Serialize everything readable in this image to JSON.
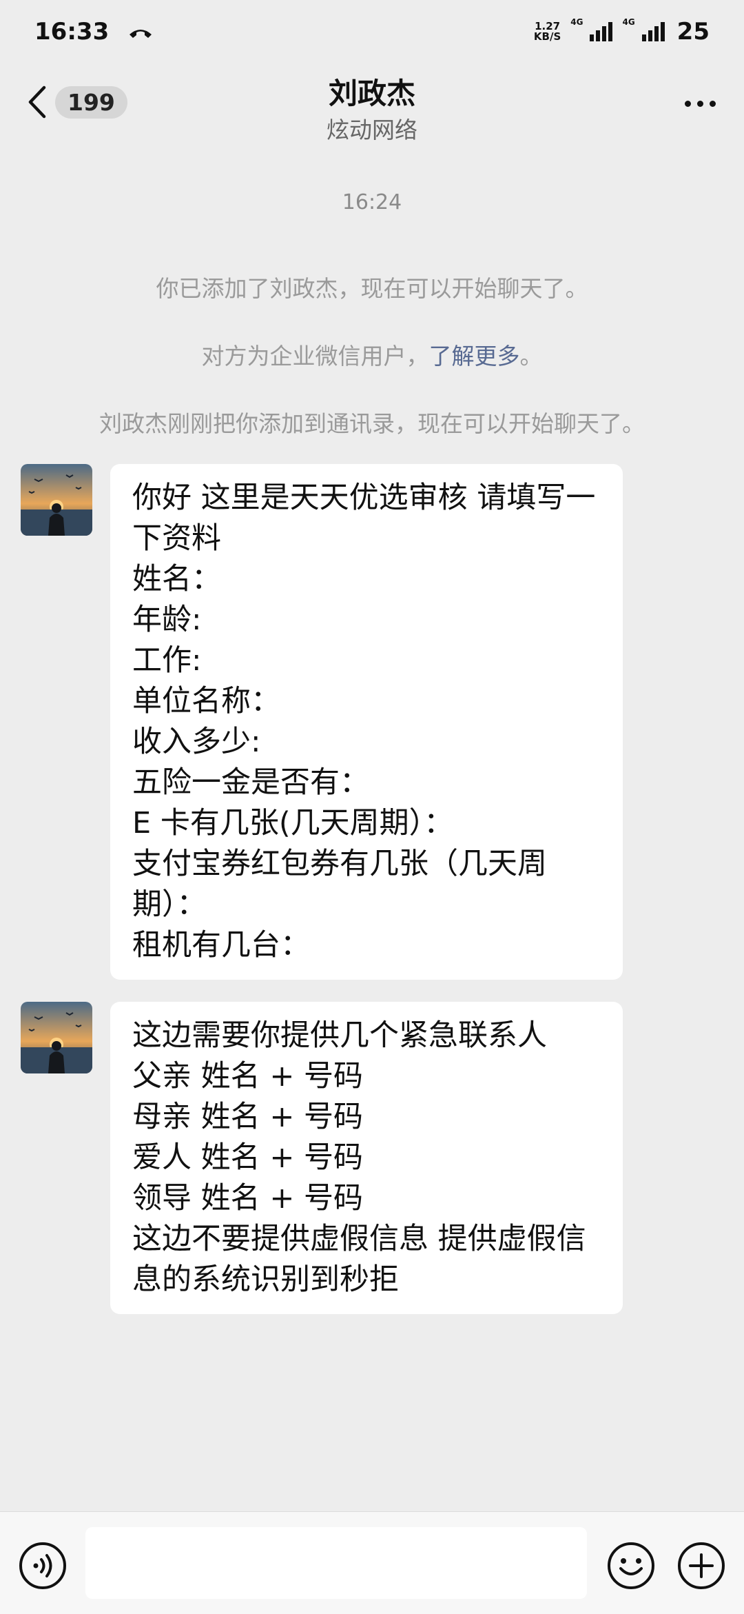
{
  "status": {
    "time": "16:33",
    "net_speed_value": "1.27",
    "net_speed_unit": "KB/S",
    "signal1_label": "4G",
    "signal2_label": "4G",
    "battery": "25"
  },
  "header": {
    "unread_count": "199",
    "title": "刘政杰",
    "subtitle": "炫动网络"
  },
  "chat": {
    "timestamp": "16:24",
    "system_messages": {
      "added": "你已添加了刘政杰，现在可以开始聊天了。",
      "enterprise_prefix": "对方为企业微信用户，",
      "enterprise_link": "了解更多",
      "enterprise_suffix": "。",
      "contacts": "刘政杰刚刚把你添加到通讯录，现在可以开始聊天了。"
    },
    "messages": [
      {
        "lines": [
          "你好 这里是天天优选审核 请填写一",
          "下资料",
          "姓名：",
          "年龄:",
          "工作:",
          "单位名称：",
          "收入多少:",
          "五险一金是否有：",
          "E 卡有几张(几天周期）：",
          "支付宝券红包券有几张（几天周",
          "期）：",
          "租机有几台："
        ]
      },
      {
        "lines": [
          "这边需要你提供几个紧急联系人",
          "父亲  姓名 + 号码",
          "母亲  姓名 + 号码",
          "爱人  姓名 + 号码",
          "领导  姓名 + 号码",
          "这边不要提供虚假信息 提供虚假信",
          "息的系统识别到秒拒"
        ]
      }
    ]
  },
  "input": {
    "placeholder": ""
  },
  "icons": {
    "call": "phone-call-icon",
    "back": "chevron-left-icon",
    "more": "more-dots-icon",
    "voice": "voice-icon",
    "emoji": "emoji-icon",
    "plus": "plus-icon"
  }
}
